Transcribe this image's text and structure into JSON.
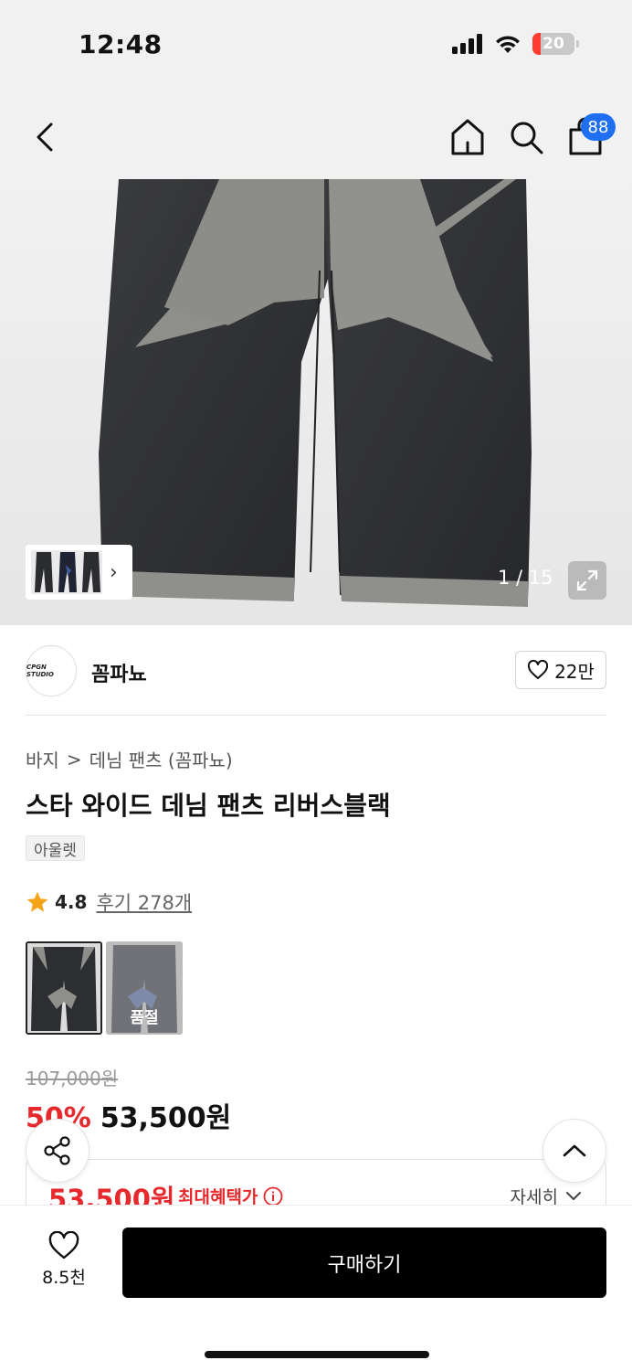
{
  "status_bar": {
    "time": "12:48",
    "battery": "20",
    "battery_level": 0.2
  },
  "nav": {
    "cart_count": "88"
  },
  "hero": {
    "image_counter": "1 / 15"
  },
  "brand": {
    "logo_text": "CPGN STUDIO",
    "name": "꼼파뇨",
    "likes": "22만"
  },
  "breadcrumb": {
    "category": "바지",
    "separator": ">",
    "subcategory": "데님 팬츠 (꼼파뇨)"
  },
  "product": {
    "title": "스타 와이드 데님 팬츠 리버스블랙",
    "tag": "아울렛",
    "rating": "4.8",
    "reviews": "후기 278개"
  },
  "color_options": [
    {
      "name": "black-grey",
      "sold_out": false
    },
    {
      "name": "navy-blue",
      "sold_out": true,
      "label": "품절"
    }
  ],
  "price": {
    "original": "107,000원",
    "discount": "50%",
    "sale": "53,500원"
  },
  "benefit": {
    "price": "53,500원",
    "label": "최대혜택가",
    "detail": "자세히"
  },
  "bottom": {
    "wish_count": "8.5천",
    "buy_label": "구매하기"
  },
  "colors": {
    "accent_red": "#e5292c",
    "badge_blue": "#1e6ff1"
  }
}
